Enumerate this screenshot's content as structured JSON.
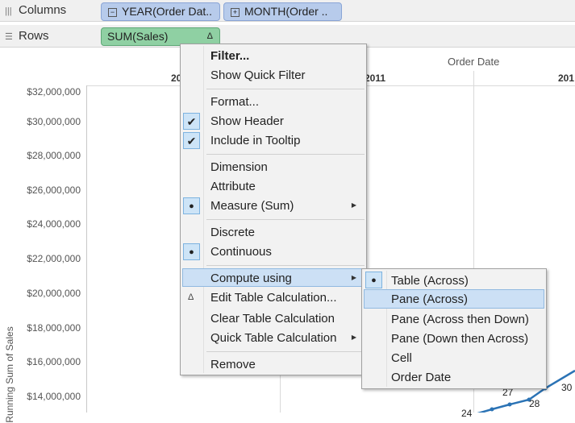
{
  "shelves": {
    "columns_label": "Columns",
    "rows_label": "Rows",
    "columns_pills": [
      "YEAR(Order Dat..",
      "MONTH(Order .."
    ],
    "rows_pill": "SUM(Sales)",
    "rows_pill_delta": "Δ"
  },
  "chart": {
    "column_header": "Order Date",
    "year_labels": [
      "20",
      "2011",
      "201"
    ],
    "y_ticks": [
      "$32,000,000",
      "$30,000,000",
      "$28,000,000",
      "$26,000,000",
      "$24,000,000",
      "$22,000,000",
      "$20,000,000",
      "$18,000,000",
      "$16,000,000",
      "$14,000,000"
    ],
    "y_axis_label": "Running Sum of Sales",
    "point_labels": [
      "27",
      "28",
      "30",
      "24"
    ],
    "line_color": "#2b73b5"
  },
  "menu": {
    "filter": "Filter...",
    "show_quick_filter": "Show Quick Filter",
    "format": "Format...",
    "show_header": "Show Header",
    "include_in_tooltip": "Include in Tooltip",
    "dimension": "Dimension",
    "attribute": "Attribute",
    "measure": "Measure (Sum)",
    "discrete": "Discrete",
    "continuous": "Continuous",
    "compute_using": "Compute using",
    "edit_table_calc": "Edit Table Calculation...",
    "clear_table_calc": "Clear Table Calculation",
    "quick_table_calc": "Quick Table Calculation",
    "remove": "Remove",
    "check_glyph": "✔",
    "dot_glyph": "●",
    "arrow_glyph": "▶",
    "delta_glyph": "Δ"
  },
  "submenu": {
    "items": [
      "Table (Across)",
      "Pane (Across)",
      "Pane (Across then Down)",
      "Pane (Down then Across)",
      "Cell",
      "Order Date"
    ]
  }
}
